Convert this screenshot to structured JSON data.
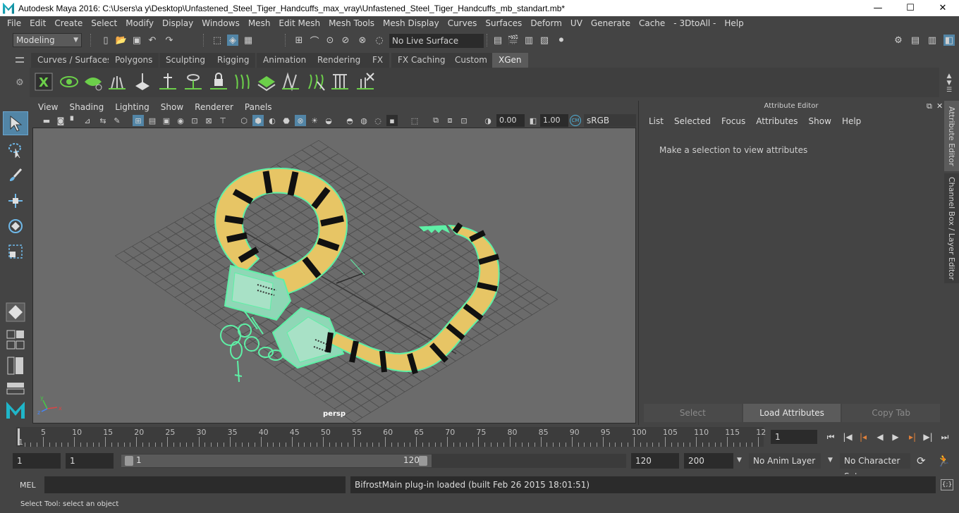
{
  "window": {
    "title": "Autodesk Maya 2016: C:\\Users\\a y\\Desktop\\Unfastened_Steel_Tiger_Handcuffs_max_vray\\Unfastened_Steel_Tiger_Handcuffs_mb_standart.mb*",
    "controls": {
      "minimize": "—",
      "maximize": "☐",
      "close": "✕"
    }
  },
  "menubar": [
    "File",
    "Edit",
    "Create",
    "Select",
    "Modify",
    "Display",
    "Windows",
    "Mesh",
    "Edit Mesh",
    "Mesh Tools",
    "Mesh Display",
    "Curves",
    "Surfaces",
    "Deform",
    "UV",
    "Generate",
    "Cache",
    "- 3DtoAll -",
    "Help"
  ],
  "statusline": {
    "mode": "Modeling",
    "live_surface": "No Live Surface"
  },
  "shelf": {
    "tabs": [
      "Curves / Surfaces",
      "Polygons",
      "Sculpting",
      "Rigging",
      "Animation",
      "Rendering",
      "FX",
      "FX Caching",
      "Custom",
      "XGen"
    ],
    "active_tab": "XGen"
  },
  "viewport": {
    "menu": [
      "View",
      "Shading",
      "Lighting",
      "Show",
      "Renderer",
      "Panels"
    ],
    "exposure": "0.00",
    "gamma_value": "1.00",
    "color_space": "sRGB gamma",
    "camera": "persp"
  },
  "attribute_editor": {
    "title": "Attribute Editor",
    "menu": [
      "List",
      "Selected",
      "Focus",
      "Attributes",
      "Show",
      "Help"
    ],
    "message": "Make a selection to view attributes",
    "buttons": {
      "select": "Select",
      "load": "Load Attributes",
      "copy": "Copy Tab"
    },
    "side_tabs": {
      "attribute": "Attribute Editor",
      "channel": "Channel Box / Layer Editor"
    }
  },
  "timeline": {
    "ticks": [
      "5",
      "10",
      "15",
      "20",
      "25",
      "30",
      "35",
      "40",
      "45",
      "50",
      "55",
      "60",
      "65",
      "70",
      "75",
      "80",
      "85",
      "90",
      "95",
      "100",
      "105",
      "110",
      "115",
      "12"
    ],
    "start_label": "1",
    "current_frame": "1"
  },
  "range": {
    "start": "1",
    "anim_start": "1",
    "inner_start": "1",
    "inner_end": "120",
    "end": "120",
    "anim_end": "200",
    "anim_layer": "No Anim Layer",
    "character_set": "No Character Set"
  },
  "command": {
    "label": "MEL",
    "result": "BifrostMain plug-in loaded (built Feb 26 2015 18:01:51)"
  },
  "help_line": "Select Tool: select an object",
  "colors": {
    "wireframe": "#5ef0a6",
    "tiger_yellow": "#e7c565",
    "stripe": "#111111",
    "viewport_bg": "#6b6b6b",
    "active_tool": "#5285a6"
  }
}
